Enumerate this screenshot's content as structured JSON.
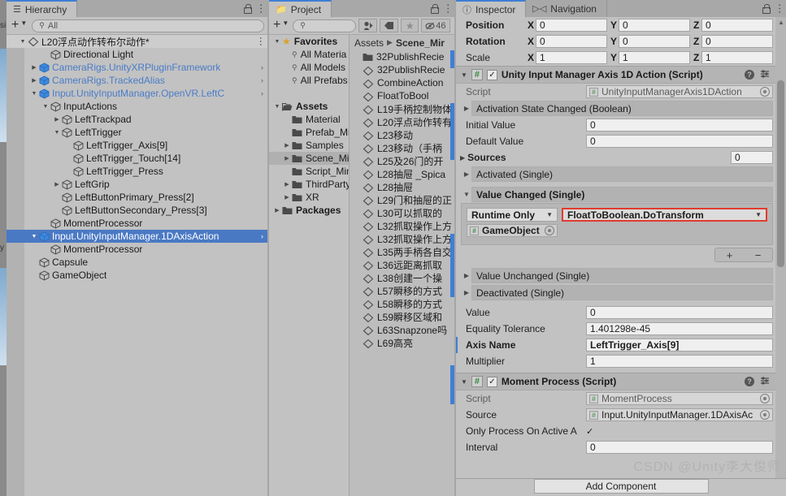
{
  "hierarchy": {
    "tab_label": "Hierarchy",
    "tab_icon": "hierarchy-icon",
    "add_label": "+",
    "search_placeholder": "All",
    "scene_name": "L20浮点动作转布尔动作*",
    "rows": [
      {
        "label": "L20浮点动作转布尔动作*",
        "depth": 0,
        "arrow": "down",
        "kind": "scene",
        "selected": false
      },
      {
        "label": "Directional Light",
        "depth": 2,
        "arrow": "none",
        "kind": "gameobject",
        "selected": false
      },
      {
        "label": "CameraRigs.UnityXRPluginFramework",
        "depth": 1,
        "arrow": "right",
        "kind": "prefab",
        "selected": false,
        "chev": true
      },
      {
        "label": "CameraRigs.TrackedAlias",
        "depth": 1,
        "arrow": "right",
        "kind": "prefab",
        "selected": false,
        "chev": true
      },
      {
        "label": "Input.UnityInputManager.OpenVR.LeftC",
        "depth": 1,
        "arrow": "down",
        "kind": "prefab",
        "selected": false,
        "chev": true
      },
      {
        "label": "InputActions",
        "depth": 2,
        "arrow": "down",
        "kind": "gameobject",
        "selected": false
      },
      {
        "label": "LeftTrackpad",
        "depth": 3,
        "arrow": "right",
        "kind": "gameobject",
        "selected": false
      },
      {
        "label": "LeftTrigger",
        "depth": 3,
        "arrow": "down",
        "kind": "gameobject",
        "selected": false
      },
      {
        "label": "LeftTrigger_Axis[9]",
        "depth": 4,
        "arrow": "none",
        "kind": "gameobject",
        "selected": false
      },
      {
        "label": "LeftTrigger_Touch[14]",
        "depth": 4,
        "arrow": "none",
        "kind": "gameobject",
        "selected": false
      },
      {
        "label": "LeftTrigger_Press",
        "depth": 4,
        "arrow": "none",
        "kind": "gameobject",
        "selected": false
      },
      {
        "label": "LeftGrip",
        "depth": 3,
        "arrow": "right",
        "kind": "gameobject",
        "selected": false
      },
      {
        "label": "LeftButtonPrimary_Press[2]",
        "depth": 3,
        "arrow": "none",
        "kind": "gameobject",
        "selected": false
      },
      {
        "label": "LeftButtonSecondary_Press[3]",
        "depth": 3,
        "arrow": "none",
        "kind": "gameobject",
        "selected": false
      },
      {
        "label": "MomentProcessor",
        "depth": 2,
        "arrow": "none",
        "kind": "gameobject",
        "selected": false
      },
      {
        "label": "Input.UnityInputManager.1DAxisAction",
        "depth": 1,
        "arrow": "down",
        "kind": "prefab",
        "selected": true,
        "chev": true
      },
      {
        "label": "MomentProcessor",
        "depth": 2,
        "arrow": "none",
        "kind": "gameobject",
        "selected": false
      },
      {
        "label": "Capsule",
        "depth": 1,
        "arrow": "none",
        "kind": "gameobject",
        "selected": false
      },
      {
        "label": "GameObject",
        "depth": 1,
        "arrow": "none",
        "kind": "gameobject",
        "selected": false
      }
    ]
  },
  "project": {
    "tab_label": "Project",
    "tab_icon": "folder-icon",
    "add_label": "+",
    "search_placeholder": "",
    "toolbar_buttons": [
      "avatar-filter-icon",
      "label-tag-icon",
      "favorite-star-icon"
    ],
    "hidden_count": "46",
    "breadcrumb": [
      "Assets",
      "Scene_Mir"
    ],
    "tree": [
      {
        "label": "Favorites",
        "depth": 0,
        "arrow": "down",
        "icon": "star",
        "bold": true
      },
      {
        "label": "All Materia",
        "depth": 1,
        "arrow": "none",
        "icon": "search",
        "bold": false
      },
      {
        "label": "All Models",
        "depth": 1,
        "arrow": "none",
        "icon": "search",
        "bold": false
      },
      {
        "label": "All Prefabs",
        "depth": 1,
        "arrow": "none",
        "icon": "search",
        "bold": false
      },
      {
        "label": "",
        "depth": 0,
        "arrow": "none",
        "icon": "none",
        "bold": false
      },
      {
        "label": "Assets",
        "depth": 0,
        "arrow": "down",
        "icon": "folder-open",
        "bold": true
      },
      {
        "label": "Material",
        "depth": 1,
        "arrow": "none",
        "icon": "folder",
        "bold": false
      },
      {
        "label": "Prefab_Mir",
        "depth": 1,
        "arrow": "none",
        "icon": "folder",
        "bold": false
      },
      {
        "label": "Samples",
        "depth": 1,
        "arrow": "right",
        "icon": "folder",
        "bold": false
      },
      {
        "label": "Scene_Min",
        "depth": 1,
        "arrow": "right",
        "icon": "folder",
        "bold": false,
        "selected": true
      },
      {
        "label": "Script_Min",
        "depth": 1,
        "arrow": "none",
        "icon": "folder",
        "bold": false
      },
      {
        "label": "ThirdParty",
        "depth": 1,
        "arrow": "right",
        "icon": "folder",
        "bold": false
      },
      {
        "label": "XR",
        "depth": 1,
        "arrow": "right",
        "icon": "folder",
        "bold": false
      },
      {
        "label": "Packages",
        "depth": 0,
        "arrow": "right",
        "icon": "folder",
        "bold": true
      }
    ],
    "assets": [
      {
        "label": "32PublishRecie",
        "type": "folder"
      },
      {
        "label": "32PublishRecie",
        "type": "scene"
      },
      {
        "label": "CombineAction",
        "type": "scene"
      },
      {
        "label": "FloatToBool",
        "type": "scene"
      },
      {
        "label": "L19手柄控制物体",
        "type": "scene"
      },
      {
        "label": "L20浮点动作转有",
        "type": "scene"
      },
      {
        "label": "L23移动",
        "type": "scene"
      },
      {
        "label": "L23移动（手柄",
        "type": "scene"
      },
      {
        "label": "L25及26门的开",
        "type": "scene"
      },
      {
        "label": "L28抽屉 _Spica",
        "type": "scene"
      },
      {
        "label": "L28抽屉",
        "type": "scene"
      },
      {
        "label": "L29门和抽屉的正",
        "type": "scene"
      },
      {
        "label": "L30可以抓取的",
        "type": "scene"
      },
      {
        "label": "L32抓取操作上方",
        "type": "scene"
      },
      {
        "label": "L32抓取操作上方",
        "type": "scene"
      },
      {
        "label": "L35两手柄各自交",
        "type": "scene"
      },
      {
        "label": "L36远距离抓取",
        "type": "scene"
      },
      {
        "label": "L38创建一个操",
        "type": "scene"
      },
      {
        "label": "L57瞬移的方式",
        "type": "scene"
      },
      {
        "label": "L58瞬移的方式",
        "type": "scene"
      },
      {
        "label": "L59瞬移区域和",
        "type": "scene"
      },
      {
        "label": "L63Snapzone吗",
        "type": "scene"
      },
      {
        "label": "L69高亮",
        "type": "scene"
      }
    ]
  },
  "inspector": {
    "tabs": [
      {
        "label": "Inspector",
        "icon": "info-icon",
        "active": true
      },
      {
        "label": "Navigation",
        "icon": "navigation-icon",
        "active": false
      }
    ],
    "transform": {
      "rows": [
        {
          "label": "Position",
          "bold": true,
          "x": "0",
          "y": "0",
          "z": "0"
        },
        {
          "label": "Rotation",
          "bold": true,
          "x": "0",
          "y": "0",
          "z": "0"
        },
        {
          "label": "Scale",
          "bold": false,
          "x": "1",
          "y": "1",
          "z": "1"
        }
      ],
      "axis_labels": [
        "X",
        "Y",
        "Z"
      ]
    },
    "component1": {
      "title": "Unity Input Manager Axis 1D Action (Script)",
      "enabled": true,
      "script_label": "Script",
      "script_value": "UnityInputManagerAxis1DAction",
      "fold_activation": "Activation State Changed (Boolean)",
      "initial_value_label": "Initial Value",
      "initial_value": "0",
      "default_value_label": "Default Value",
      "default_value": "0",
      "sources_label": "Sources",
      "sources_value": "0",
      "fold_activated": "Activated (Single)",
      "fold_value_changed": "Value Changed (Single)",
      "event_mode": "Runtime Only",
      "event_function": "FloatToBoolean.DoTransform",
      "event_target": "GameObject",
      "add_btn": "+",
      "remove_btn": "−",
      "fold_value_unchanged": "Value Unchanged (Single)",
      "fold_deactivated": "Deactivated (Single)",
      "fields": [
        {
          "label": "Value",
          "value": "0",
          "bold": false
        },
        {
          "label": "Equality Tolerance",
          "value": "1.401298e-45",
          "bold": false
        },
        {
          "label": "Axis Name",
          "value": "LeftTrigger_Axis[9]",
          "bold": true
        },
        {
          "label": "Multiplier",
          "value": "1",
          "bold": false
        }
      ]
    },
    "component2": {
      "title": "Moment Process (Script)",
      "enabled": true,
      "script_label": "Script",
      "script_value": "MomentProcess",
      "source_label": "Source",
      "source_value": "Input.UnityInputManager.1DAxisAc",
      "only_process_label": "Only Process On Active A",
      "only_process_checked": true,
      "interval_label": "Interval",
      "interval_value": "0"
    },
    "add_component_label": "Add Component"
  },
  "watermark": "CSDN @Unity李大俊师",
  "colors": {
    "selection_blue": "#4a79c4",
    "prefab_blue": "#4a7cc8",
    "highlight_red": "#e23b2e",
    "panel_bg": "#c2c2c2",
    "tabbar_bg": "#a8a8a8",
    "accent_tab": "#3f7fd4"
  }
}
